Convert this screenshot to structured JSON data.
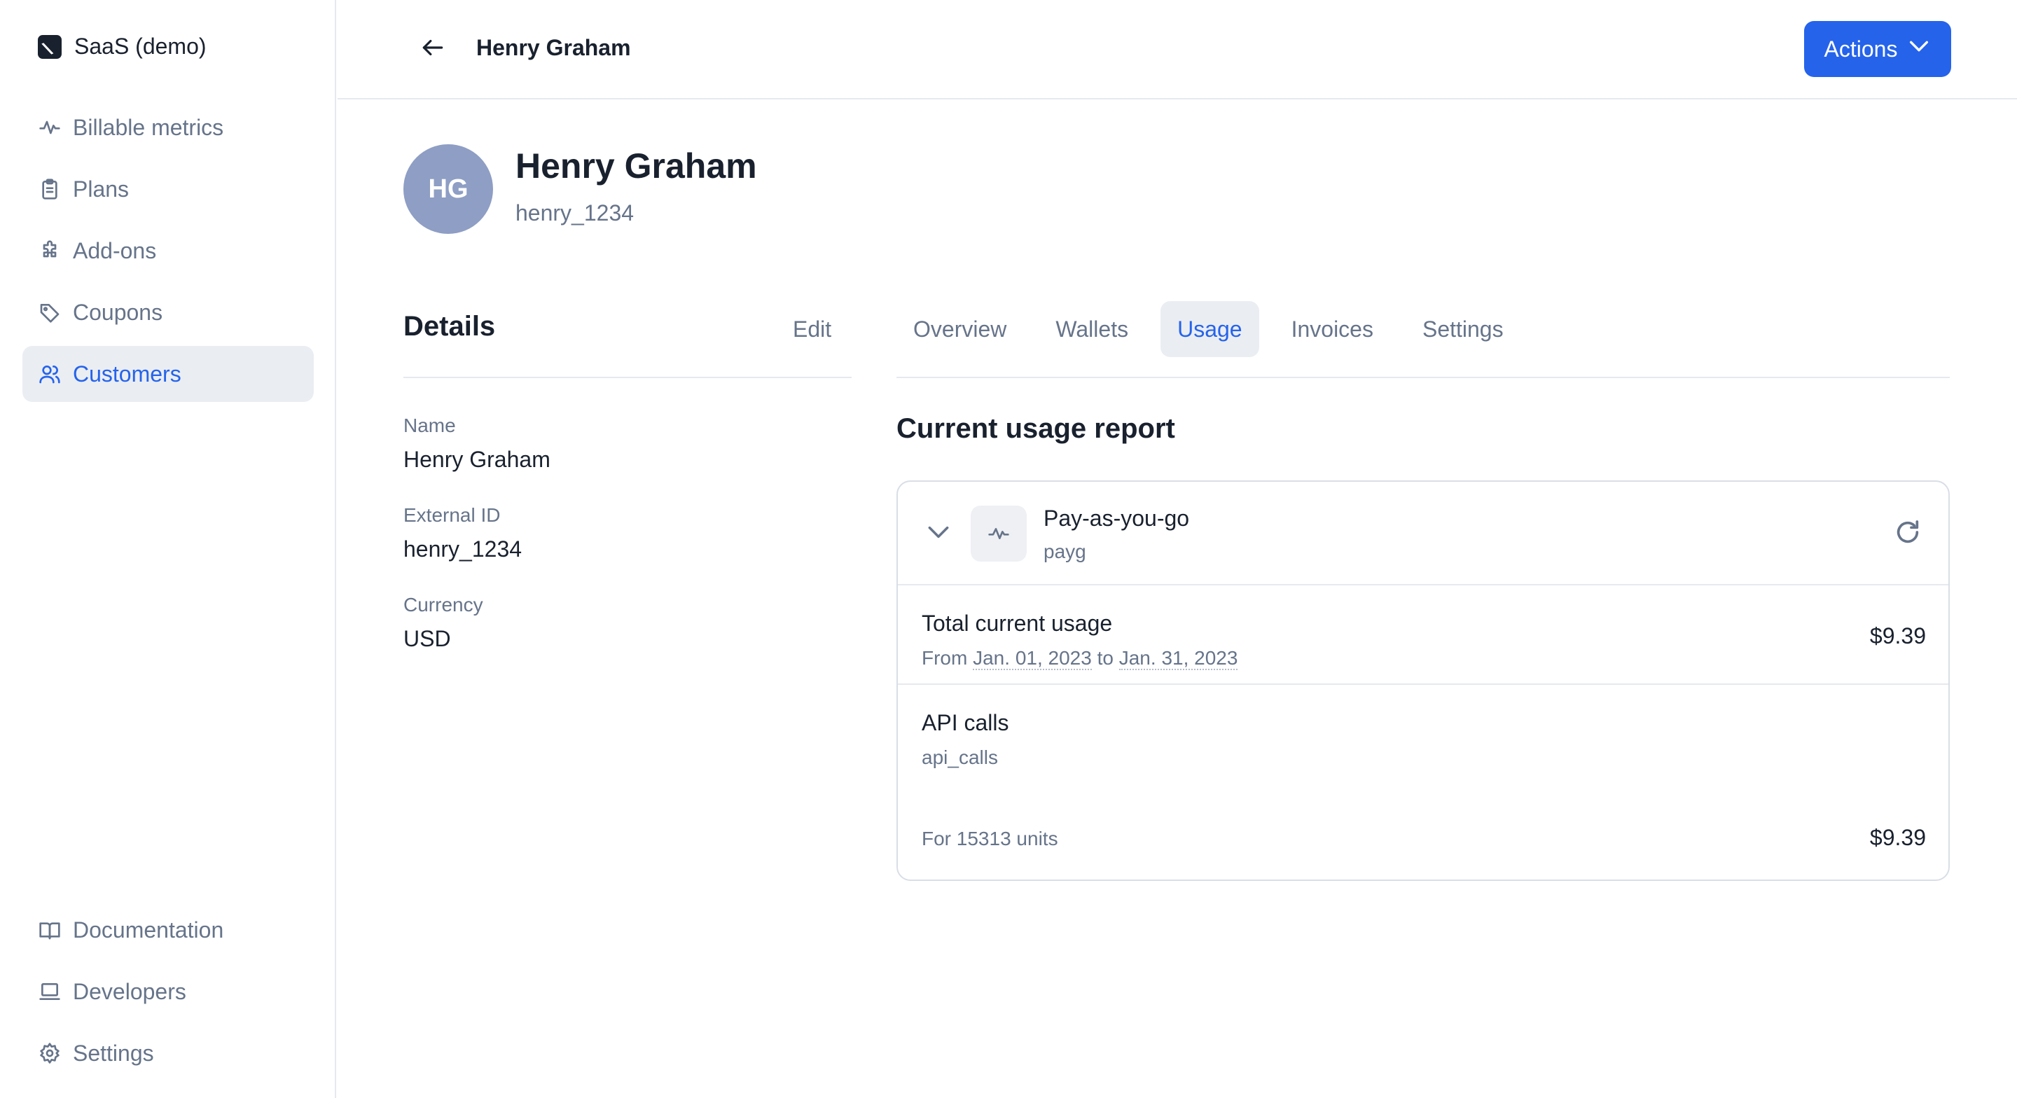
{
  "sidebar": {
    "org_name": "SaaS (demo)",
    "top_items": [
      {
        "label": "Billable metrics",
        "icon": "pulse-icon"
      },
      {
        "label": "Plans",
        "icon": "clipboard-icon"
      },
      {
        "label": "Add-ons",
        "icon": "puzzle-icon"
      },
      {
        "label": "Coupons",
        "icon": "tag-icon"
      },
      {
        "label": "Customers",
        "icon": "users-icon",
        "active": true
      }
    ],
    "bottom_items": [
      {
        "label": "Documentation",
        "icon": "book-icon"
      },
      {
        "label": "Developers",
        "icon": "laptop-icon"
      },
      {
        "label": "Settings",
        "icon": "gear-icon"
      }
    ]
  },
  "header": {
    "title": "Henry Graham",
    "actions_label": "Actions"
  },
  "profile": {
    "initials": "HG",
    "name": "Henry Graham",
    "external_id": "henry_1234"
  },
  "details": {
    "title": "Details",
    "edit_label": "Edit",
    "fields": [
      {
        "label": "Name",
        "value": "Henry Graham"
      },
      {
        "label": "External ID",
        "value": "henry_1234"
      },
      {
        "label": "Currency",
        "value": "USD"
      }
    ]
  },
  "tabs": [
    {
      "label": "Overview"
    },
    {
      "label": "Wallets"
    },
    {
      "label": "Usage",
      "active": true
    },
    {
      "label": "Invoices"
    },
    {
      "label": "Settings"
    }
  ],
  "usage": {
    "section_title": "Current usage report",
    "plan_name": "Pay-as-you-go",
    "plan_code": "payg",
    "total_label": "Total current usage",
    "period_from_prefix": "From",
    "period_from": "Jan. 01, 2023",
    "period_to_prefix": "to",
    "period_to": "Jan. 31, 2023",
    "total_amount": "$9.39",
    "metric_name": "API calls",
    "metric_code": "api_calls",
    "metric_units": "For 15313 units",
    "metric_amount": "$9.39"
  },
  "colors": {
    "accent": "#2563eb",
    "avatar": "#8e9ec4",
    "muted_text": "#66748a",
    "active_bg": "#eaedf2"
  }
}
